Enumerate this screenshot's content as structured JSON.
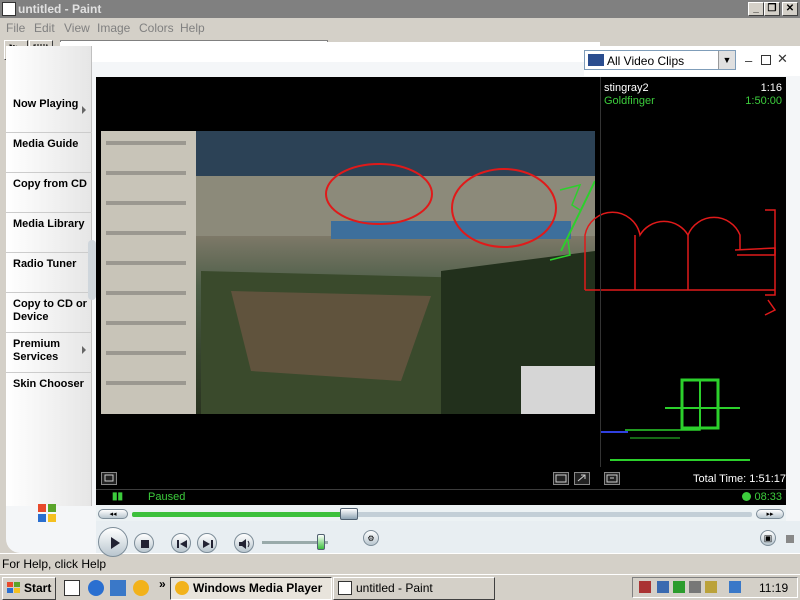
{
  "paint": {
    "title": "untitled - Paint",
    "menu": [
      "File",
      "Edit",
      "View",
      "Image",
      "Colors",
      "Help"
    ],
    "status": "For Help, click Help"
  },
  "wmp": {
    "taskbar_items": [
      "Now Playing",
      "Media Guide",
      "Copy from CD",
      "Media Library",
      "Radio Tuner",
      "Copy to CD or Device",
      "Premium Services",
      "Skin Chooser"
    ],
    "playlist_select": "All Video Clips",
    "playlist": [
      {
        "title": "stingray2",
        "duration": "1:16",
        "active": false
      },
      {
        "title": "Goldfinger",
        "duration": "1:50:00",
        "active": true
      }
    ],
    "total_time_label": "Total Time: 1:51:17",
    "status": "Paused",
    "elapsed": "08:33",
    "seek_progress": 0.35,
    "volume": 0.9,
    "colors": {
      "accent_green": "#3ccc3c",
      "wmp_blue": "#2a4d8f"
    }
  },
  "taskbar": {
    "start_label": "Start",
    "overflow": "»",
    "buttons": [
      "Windows Media Player",
      "untitled - Paint"
    ],
    "clock": "11:19"
  }
}
